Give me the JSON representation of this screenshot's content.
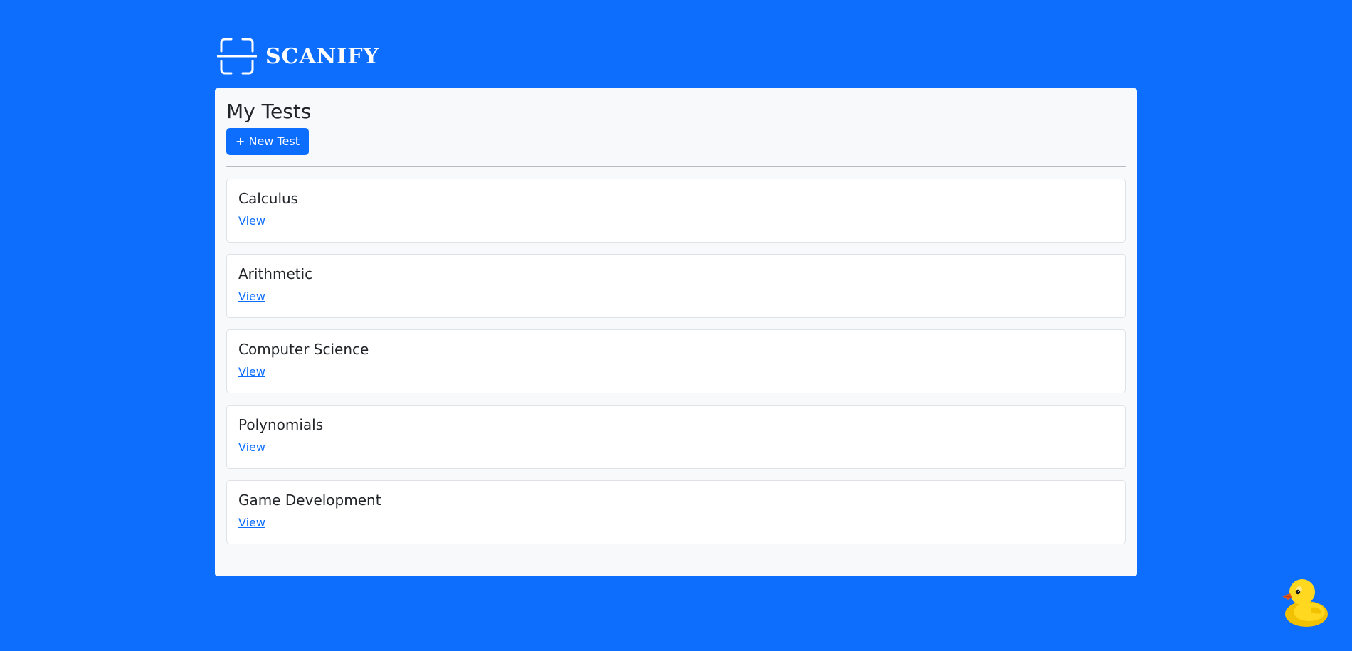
{
  "app": {
    "brand_name": "SCANIFY",
    "logo_icon": "scan-frame-icon",
    "accent_color": "#0d6efd"
  },
  "main": {
    "title": "My Tests",
    "new_test_label": "+ New Test",
    "tests": [
      {
        "name": "Calculus",
        "link_label": "View"
      },
      {
        "name": "Arithmetic",
        "link_label": "View"
      },
      {
        "name": "Computer Science",
        "link_label": "View"
      },
      {
        "name": "Polynomials",
        "link_label": "View"
      },
      {
        "name": "Game Development",
        "link_label": "View"
      }
    ]
  },
  "decor": {
    "mascot_icon": "rubber-duck-icon"
  }
}
